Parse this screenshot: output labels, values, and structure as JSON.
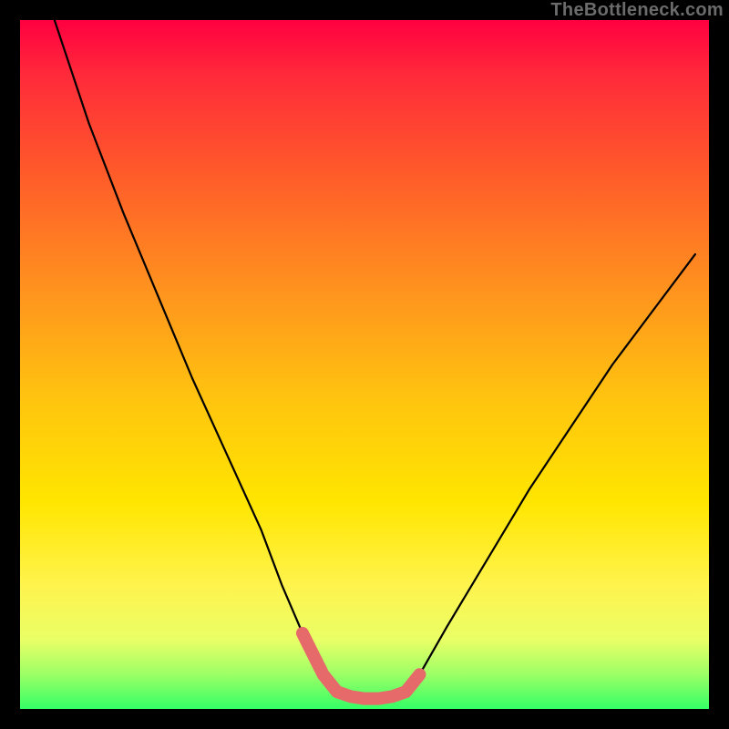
{
  "watermark": "TheBottleneck.com",
  "chart_data": {
    "type": "line",
    "title": "",
    "xlabel": "",
    "ylabel": "",
    "xlim": [
      0,
      100
    ],
    "ylim": [
      0,
      100
    ],
    "grid": false,
    "series": [
      {
        "name": "bottleneck-curve",
        "color": "#000000",
        "x": [
          5,
          10,
          15,
          20,
          25,
          30,
          35,
          38,
          41,
          44,
          46,
          48,
          50,
          52,
          54,
          56,
          58,
          62,
          68,
          74,
          80,
          86,
          92,
          98
        ],
        "y": [
          100,
          85,
          72,
          60,
          48,
          37,
          26,
          18,
          11,
          5,
          2.5,
          1.8,
          1.5,
          1.5,
          1.8,
          2.5,
          5,
          12,
          22,
          32,
          41,
          50,
          58,
          66
        ]
      },
      {
        "name": "optimal-zone-highlight",
        "color": "#e66a6a",
        "x": [
          41,
          44,
          46,
          48,
          50,
          52,
          54,
          56,
          58
        ],
        "y": [
          11,
          5,
          2.5,
          1.8,
          1.5,
          1.5,
          1.8,
          2.5,
          5
        ]
      }
    ],
    "watermark_text": "TheBottleneck.com"
  }
}
